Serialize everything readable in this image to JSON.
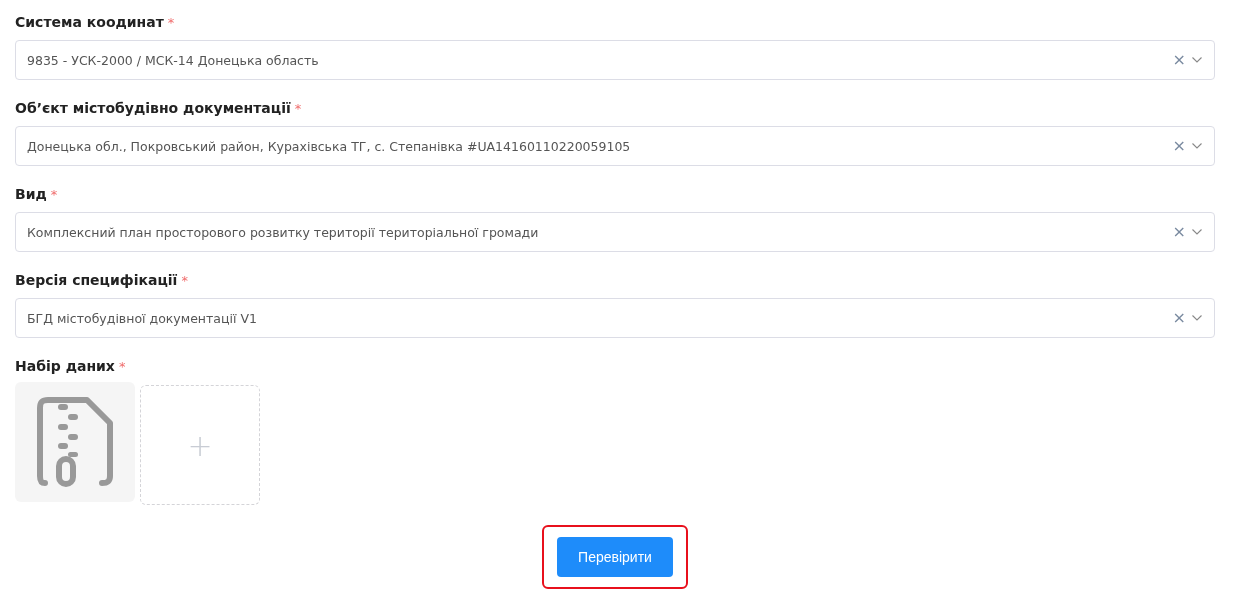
{
  "fields": [
    {
      "label": "Система коодинат",
      "required_mark": "*",
      "value": "9835 - УСК-2000 / МСК-14 Донецька область",
      "clear": "×"
    },
    {
      "label": "Об’єкт містобудівно документації",
      "required_mark": "*",
      "value": "Донецька обл., Покровський район, Курахівська ТГ, с. Степанівка #UA14160110220059105",
      "clear": "×"
    },
    {
      "label": "Вид",
      "required_mark": "*",
      "value": "Комплексний план просторового розвитку території територіальної громади",
      "clear": "×"
    },
    {
      "label": "Версія специфікації",
      "required_mark": "*",
      "value": "БГД містобудівної документації V1",
      "clear": "×"
    }
  ],
  "upload": {
    "label": "Набір даних",
    "required_mark": "*",
    "files": [
      {
        "kind": "archive"
      }
    ],
    "add_label": "+"
  },
  "submit": {
    "label": "Перевірити",
    "highlighted": true
  }
}
